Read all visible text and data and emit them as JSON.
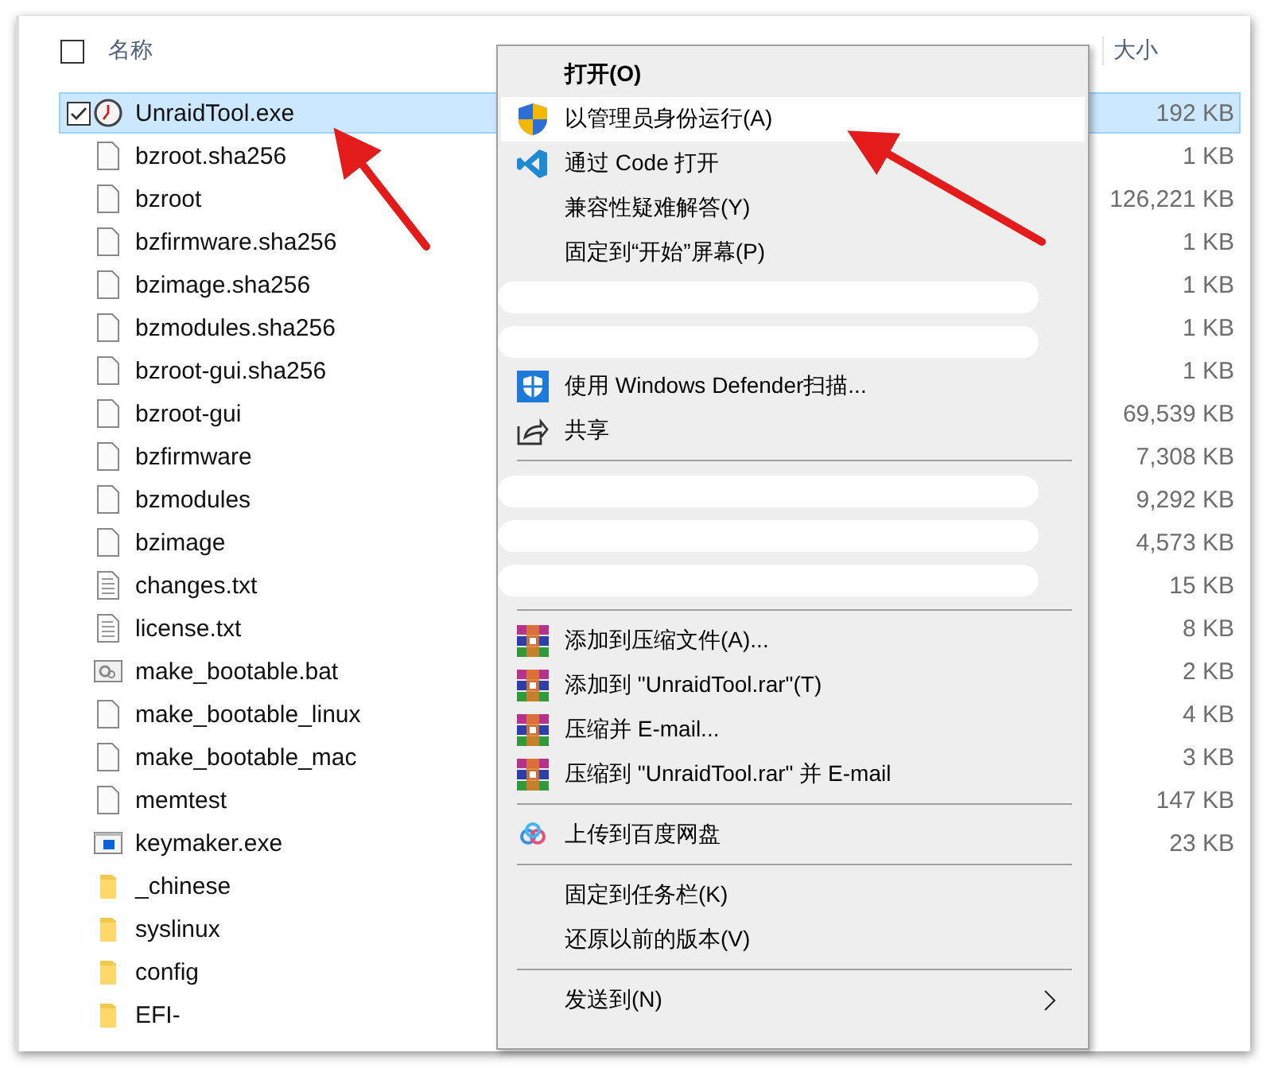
{
  "header": {
    "select_all": {
      "checked": false
    },
    "columns": [
      {
        "kind": "name",
        "label": "名称"
      },
      {
        "kind": "size",
        "label": "大小"
      }
    ]
  },
  "files": [
    {
      "kind": "app",
      "name": "UnraidTool.exe",
      "size": "192 KB",
      "selected": true
    },
    {
      "kind": "file",
      "name": "bzroot.sha256",
      "size": "1 KB",
      "selected": false
    },
    {
      "kind": "file",
      "name": "bzroot",
      "size": "126,221 KB",
      "selected": false
    },
    {
      "kind": "file",
      "name": "bzfirmware.sha256",
      "size": "1 KB",
      "selected": false
    },
    {
      "kind": "file",
      "name": "bzimage.sha256",
      "size": "1 KB",
      "selected": false
    },
    {
      "kind": "file",
      "name": "bzmodules.sha256",
      "size": "1 KB",
      "selected": false
    },
    {
      "kind": "file",
      "name": "bzroot-gui.sha256",
      "size": "1 KB",
      "selected": false
    },
    {
      "kind": "file",
      "name": "bzroot-gui",
      "size": "69,539 KB",
      "selected": false
    },
    {
      "kind": "file",
      "name": "bzfirmware",
      "size": "7,308 KB",
      "selected": false
    },
    {
      "kind": "file",
      "name": "bzmodules",
      "size": "9,292 KB",
      "selected": false
    },
    {
      "kind": "file",
      "name": "bzimage",
      "size": "4,573 KB",
      "selected": false
    },
    {
      "kind": "text",
      "name": "changes.txt",
      "size": "15 KB",
      "selected": false
    },
    {
      "kind": "text",
      "name": "license.txt",
      "size": "8 KB",
      "selected": false
    },
    {
      "kind": "script",
      "name": "make_bootable.bat",
      "size": "2 KB",
      "selected": false
    },
    {
      "kind": "file",
      "name": "make_bootable_linux",
      "size": "4 KB",
      "selected": false
    },
    {
      "kind": "file",
      "name": "make_bootable_mac",
      "size": "3 KB",
      "selected": false
    },
    {
      "kind": "file",
      "name": "memtest",
      "size": "147 KB",
      "selected": false
    },
    {
      "kind": "program",
      "name": "keymaker.exe",
      "size": "23 KB",
      "selected": false
    },
    {
      "kind": "folder",
      "name": "_chinese",
      "selected": false
    },
    {
      "kind": "folder",
      "name": "syslinux",
      "selected": false
    },
    {
      "kind": "folder",
      "name": "config",
      "selected": false
    },
    {
      "kind": "folder",
      "name": "EFI-",
      "selected": false
    }
  ],
  "context_menu": [
    {
      "kind": "plain",
      "label": "打开(O)",
      "default": true,
      "selected": false
    },
    {
      "kind": "shield",
      "label": "以管理员身份运行(A)",
      "default": false,
      "selected": true
    },
    {
      "kind": "vscode",
      "label": "通过 Code 打开",
      "default": false,
      "selected": false
    },
    {
      "kind": "plain",
      "label": "兼容性疑难解答(Y)",
      "default": false,
      "selected": false
    },
    {
      "kind": "plain",
      "label": "固定到“开始”屏幕(P)",
      "default": false,
      "selected": false
    },
    {
      "kind": "redacted"
    },
    {
      "kind": "redacted"
    },
    {
      "kind": "defender",
      "label": "使用 Windows Defender扫描...",
      "default": false,
      "selected": false
    },
    {
      "kind": "share",
      "label": "共享",
      "default": false,
      "selected": false
    },
    {
      "kind": "separator"
    },
    {
      "kind": "redacted"
    },
    {
      "kind": "redacted"
    },
    {
      "kind": "redacted"
    },
    {
      "kind": "separator"
    },
    {
      "kind": "archive",
      "label": "添加到压缩文件(A)...",
      "default": false,
      "selected": false
    },
    {
      "kind": "archive",
      "label": "添加到 \"UnraidTool.rar\"(T)",
      "default": false,
      "selected": false
    },
    {
      "kind": "archive",
      "label": "压缩并 E-mail...",
      "default": false,
      "selected": false
    },
    {
      "kind": "archive",
      "label": "压缩到 \"UnraidTool.rar\" 并 E-mail",
      "default": false,
      "selected": false
    },
    {
      "kind": "separator"
    },
    {
      "kind": "cloud",
      "label": "上传到百度网盘",
      "default": false,
      "selected": false
    },
    {
      "kind": "separator"
    },
    {
      "kind": "plain",
      "label": "固定到任务栏(K)",
      "default": false,
      "selected": false
    },
    {
      "kind": "plain",
      "label": "还原以前的版本(V)",
      "default": false,
      "selected": false
    },
    {
      "kind": "separator"
    },
    {
      "kind": "submenu",
      "label": "发送到(N)",
      "default": false,
      "selected": false
    }
  ]
}
